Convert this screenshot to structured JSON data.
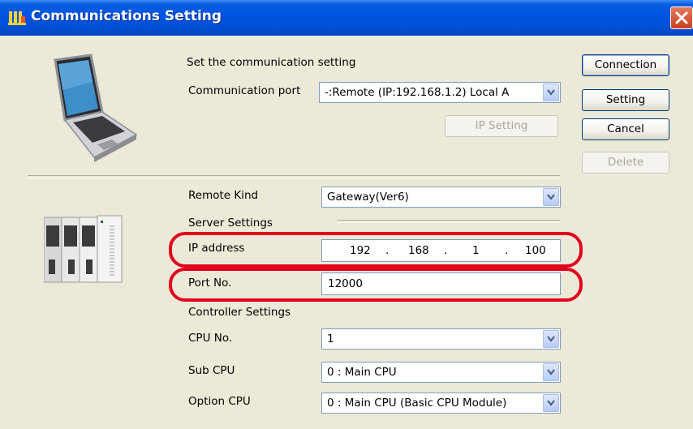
{
  "window": {
    "title": "Communications Setting"
  },
  "comm": {
    "heading": "Set the communication setting",
    "port_label": "Communication port",
    "port_value": "-:Remote  (IP:192.168.1.2) Local A",
    "ip_setting_btn": "IP Setting"
  },
  "buttons": {
    "connection": "Connection",
    "setting": "Setting",
    "cancel": "Cancel",
    "delete": "Delete"
  },
  "remote": {
    "kind_label": "Remote Kind",
    "kind_value": "Gateway(Ver6)",
    "server_heading": "Server Settings",
    "ip_label": "IP address",
    "ip": [
      "192",
      ".",
      "168",
      ".",
      "1",
      ".",
      "100"
    ],
    "port_label": "Port No.",
    "port_value": "12000"
  },
  "controller": {
    "heading": "Controller Settings",
    "cpu_label": "CPU No.",
    "cpu_value": "1",
    "sub_label": "Sub CPU",
    "sub_value": "0 : Main CPU",
    "option_label": "Option CPU",
    "option_value": "0 : Main CPU (Basic CPU Module)"
  },
  "colors": {
    "title_bar": "#0054e3",
    "highlight": "#e3001b",
    "face": "#ece9d8"
  },
  "icons": [
    "app-icon",
    "close-icon",
    "laptop-icon",
    "plc-modules-icon",
    "dropdown-arrow-icon"
  ]
}
